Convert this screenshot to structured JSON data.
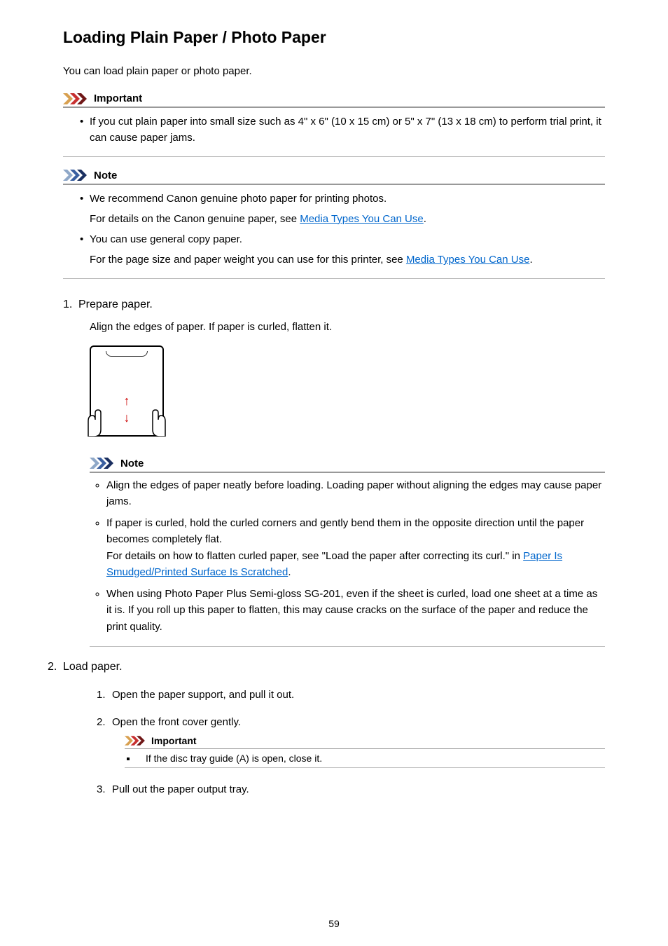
{
  "title": "Loading Plain Paper / Photo Paper",
  "intro": "You can load plain paper or photo paper.",
  "important1": {
    "label": "Important",
    "items": [
      {
        "text": "If you cut plain paper into small size such as 4\" x 6\" (10 x 15 cm) or 5\" x 7\" (13 x 18 cm) to perform trial print, it can cause paper jams."
      }
    ]
  },
  "note1": {
    "label": "Note",
    "items": [
      {
        "text": "We recommend Canon genuine photo paper for printing photos.",
        "sub_pre": "For details on the Canon genuine paper, see ",
        "sub_link": "Media Types You Can Use",
        "sub_post": "."
      },
      {
        "text": "You can use general copy paper.",
        "sub_pre": "For the page size and paper weight you can use for this printer, see ",
        "sub_link": "Media Types You Can Use",
        "sub_post": "."
      }
    ]
  },
  "step1": {
    "title": "Prepare paper.",
    "desc": "Align the edges of paper. If paper is curled, flatten it.",
    "note": {
      "label": "Note",
      "items": [
        {
          "text": "Align the edges of paper neatly before loading. Loading paper without aligning the edges may cause paper jams."
        },
        {
          "text": "If paper is curled, hold the curled corners and gently bend them in the opposite direction until the paper becomes completely flat.",
          "sub_pre": "For details on how to flatten curled paper, see \"Load the paper after correcting its curl.\" in ",
          "sub_link": "Paper Is Smudged/Printed Surface Is Scratched",
          "sub_post": "."
        },
        {
          "text": "When using Photo Paper Plus Semi-gloss SG-201, even if the sheet is curled, load one sheet at a time as it is. If you roll up this paper to flatten, this may cause cracks on the surface of the paper and reduce the print quality."
        }
      ]
    }
  },
  "step2": {
    "title": "Load paper.",
    "subs": [
      {
        "text": "Open the paper support, and pull it out."
      },
      {
        "text": "Open the front cover gently.",
        "important": {
          "label": "Important",
          "items": [
            {
              "text": "If the disc tray guide (A) is open, close it."
            }
          ]
        }
      },
      {
        "text": "Pull out the paper output tray."
      }
    ]
  },
  "page_number": "59"
}
